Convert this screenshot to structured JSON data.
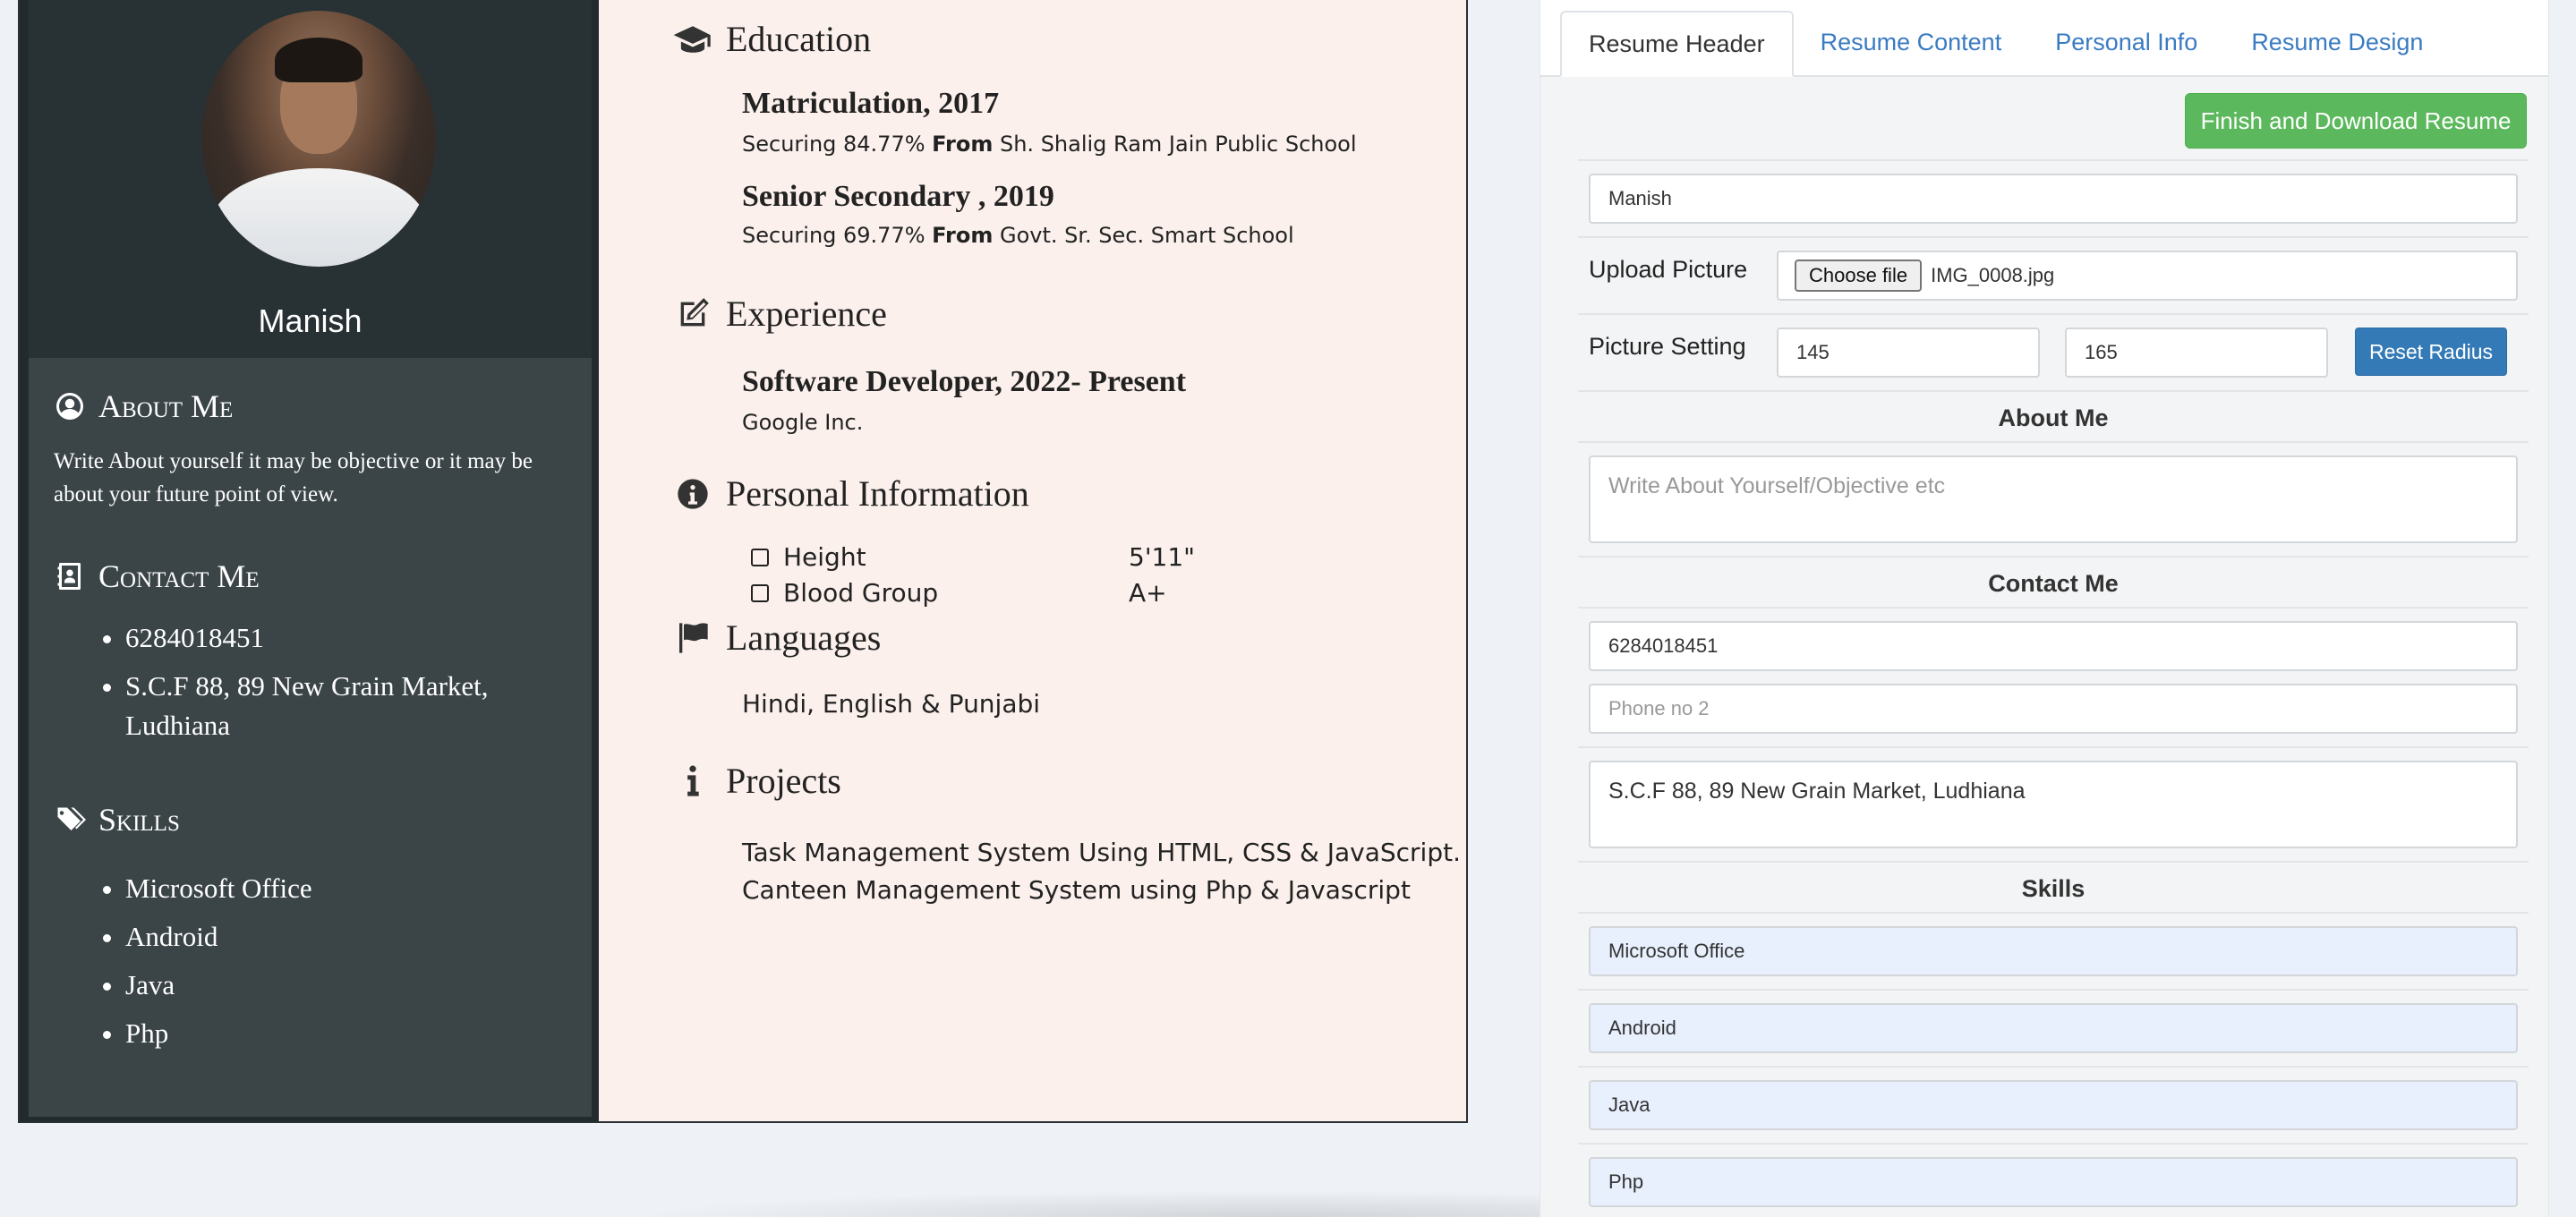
{
  "resume": {
    "name": "Manish",
    "about": {
      "heading": "About Me",
      "text": "Write About yourself it may be objective or it may be about your future point of view."
    },
    "contact": {
      "heading": "Contact Me",
      "items": [
        "6284018451",
        "S.C.F 88, 89 New Grain Market, Ludhiana"
      ]
    },
    "skills": {
      "heading": "Skills",
      "items": [
        "Microsoft Office",
        "Android",
        "Java",
        "Php"
      ]
    },
    "education": {
      "heading": "Education",
      "items": [
        {
          "title": "Matriculation, 2017",
          "pre": "Securing 84.77% ",
          "from": "From",
          "post": " Sh. Shalig Ram Jain Public School"
        },
        {
          "title": "Senior Secondary , 2019",
          "pre": "Securing 69.77% ",
          "from": "From",
          "post": " Govt. Sr. Sec. Smart School"
        }
      ]
    },
    "experience": {
      "heading": "Experience",
      "items": [
        {
          "title": "Software Developer, 2022- Present",
          "sub": "Google Inc."
        }
      ]
    },
    "personal": {
      "heading": "Personal Information",
      "rows": [
        {
          "label": "Height",
          "value": "5'11\""
        },
        {
          "label": "Blood Group",
          "value": "A+"
        }
      ]
    },
    "languages": {
      "heading": "Languages",
      "text": "Hindi, English & Punjabi"
    },
    "projects": {
      "heading": "Projects",
      "lines": [
        "Task Management System Using HTML, CSS & JavaScript.",
        "Canteen Management System using Php & Javascript"
      ]
    }
  },
  "editor": {
    "tabs": [
      "Resume Header",
      "Resume Content",
      "Personal Info",
      "Resume Design"
    ],
    "active_tab": "Resume Header",
    "finish_label": "Finish and Download Resume",
    "name_value": "Manish",
    "upload_label": "Upload Picture",
    "choose_file_label": "Choose file",
    "file_name": "IMG_0008.jpg",
    "picture_setting_label": "Picture Setting",
    "picture_setting_values": [
      "145",
      "165"
    ],
    "reset_label": "Reset Radius",
    "about_title": "About Me",
    "about_placeholder": "Write About Yourself/Objective etc",
    "contact_title": "Contact Me",
    "phone1": "6284018451",
    "phone2_placeholder": "Phone no 2",
    "address": "S.C.F 88, 89 New Grain Market, Ludhiana",
    "skills_title": "Skills",
    "skills": [
      "Microsoft Office",
      "Android",
      "Java",
      "Php"
    ]
  },
  "colors": {
    "sidebar_dark": "#2b3336",
    "sidebar_body": "#3b4548",
    "resume_bg": "#fbf0ec",
    "finish_btn": "#5cb85c",
    "reset_btn": "#337ab7",
    "tab_link": "#3a7bc2"
  },
  "icons": {
    "about": "user-circle-icon",
    "contact": "address-book-icon",
    "skills": "tags-icon",
    "education": "graduation-cap-icon",
    "experience": "edit-icon",
    "personal": "info-circle-icon",
    "languages": "flag-icon",
    "projects": "info-icon"
  }
}
